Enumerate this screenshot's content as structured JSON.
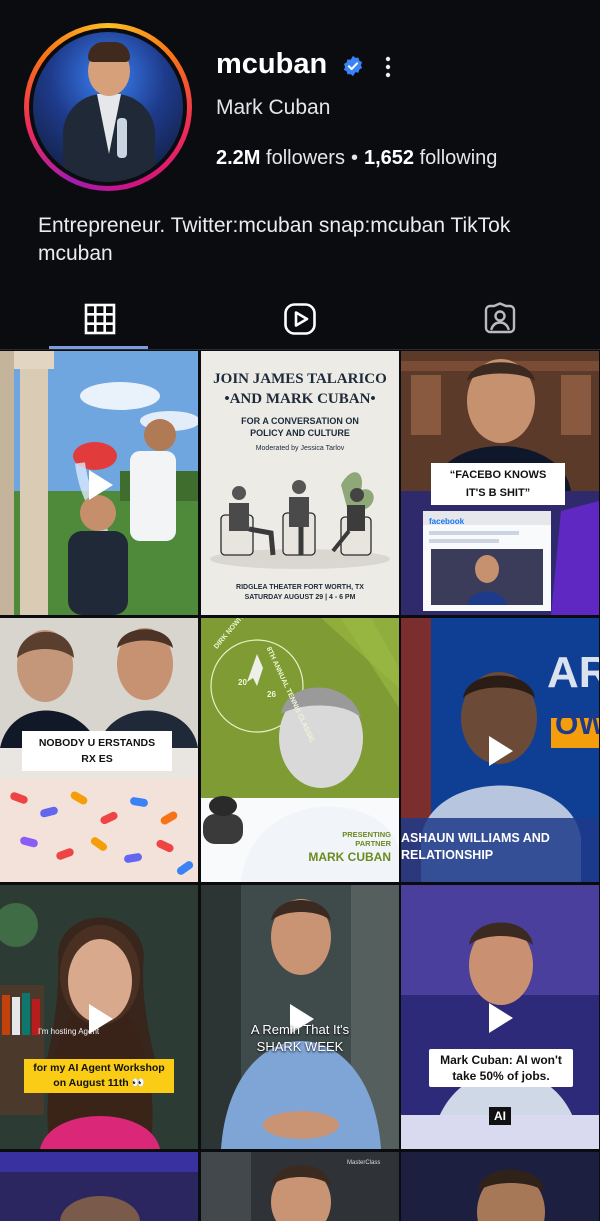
{
  "profile": {
    "username": "mcuban",
    "full_name": "Mark Cuban",
    "followers_count": "2.2M",
    "followers_label": "followers",
    "following_count": "1,652",
    "following_label": "following",
    "bio_line1": "Entrepreneur. Twitter:mcuban snap:mcuban TikTok",
    "bio_line2": "mcuban",
    "verified_color": "#3b82f6"
  },
  "tabs": [
    {
      "icon": "grid-icon",
      "selected": true
    },
    {
      "icon": "reels-icon",
      "selected": false
    },
    {
      "icon": "tagged-icon",
      "selected": false
    }
  ],
  "posts": {
    "p2": {
      "title_line1": "JOIN JAMES TALARICO",
      "title_line2": "•AND MARK CUBAN•",
      "subtitle_line1": "FOR A CONVERSATION ON",
      "subtitle_line2": "POLICY AND CULTURE",
      "moderator": "Moderated by Jessica Tarlov",
      "venue_line1": "RIDGLEA THEATER FORT WORTH, TX",
      "venue_line2": "SATURDAY AUGUST 29 | 4 - 6 PM"
    },
    "p3": {
      "caption_line1": "“FACEBO  KNOWS",
      "caption_line2": "IT'S B    SHIT”",
      "screen_label": "facebook"
    },
    "p4": {
      "caption_line1": "NOBODY U  ERSTANDS",
      "caption_line2": "RX     ES"
    },
    "p5": {
      "ring_text": "DIRK NOWITZKI FOUNDATION",
      "ring_text2": "8TH ANNUAL TENNIS CLASSIC",
      "year_left": "20",
      "year_right": "26",
      "presenting_line1": "PRESENTING",
      "presenting_line2": "PARTNER",
      "partner_name": "MARK CUBAN"
    },
    "p6": {
      "caption_line1": "ASHAUN WILLIAMS AND",
      "caption_line2": "RELATIONSHIP",
      "bg_letters1": "AR",
      "bg_letters2": "OW"
    },
    "p7": {
      "small_text": "I'm hosting      Agent",
      "caption_line1": "for my AI Agent Workshop",
      "caption_line2": "on August 11th 👀"
    },
    "p8": {
      "caption_line1": "A Remin   That It's",
      "caption_line2": "SHARK WEEK"
    },
    "p9": {
      "caption_line1": "Mark Cuban: AI won't",
      "caption_line2": "take 50% of jobs.",
      "badge": "AI"
    },
    "p11": {
      "small_text": "MasterClass"
    }
  }
}
